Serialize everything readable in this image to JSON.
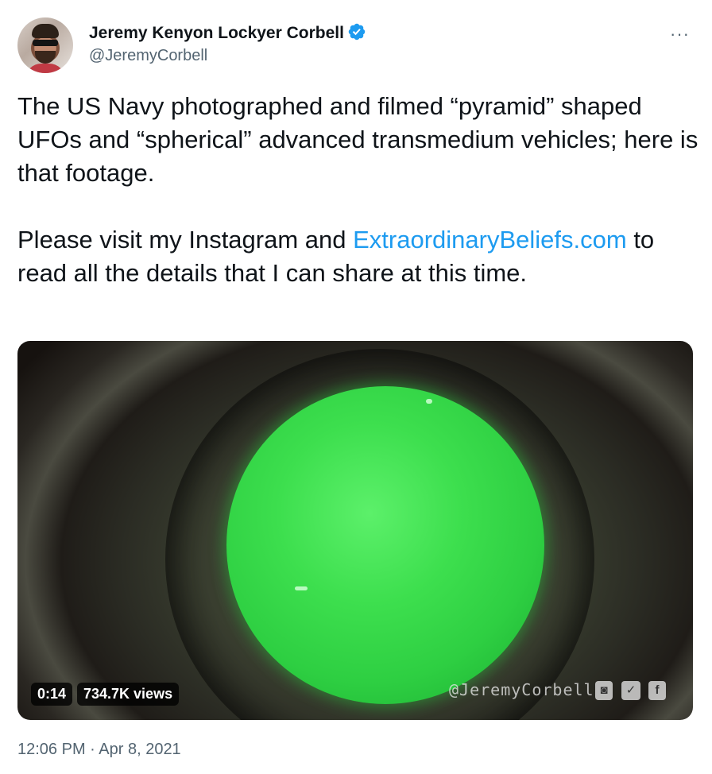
{
  "author": {
    "name": "Jeremy Kenyon Lockyer Corbell",
    "handle": "@JeremyCorbell",
    "verified": true
  },
  "menu": {
    "more_label": "···"
  },
  "tweet": {
    "text_part1": "The US Navy photographed and filmed “pyramid” shaped UFOs and “spherical” advanced transmedium vehicles; here is that footage.\n\nPlease visit my Instagram and ",
    "link_text": "ExtraordinaryBeliefs.com",
    "text_part2": " to read all the details that I can share at this time."
  },
  "video": {
    "duration": "0:14",
    "views": "734.7K views",
    "watermark": "@JeremyCorbell",
    "social_icons": [
      "instagram-icon",
      "twitter-icon",
      "facebook-icon"
    ]
  },
  "timestamp": "12:06 PM · Apr 8, 2021",
  "colors": {
    "link": "#1d9bf0",
    "verified": "#1d9bf0",
    "secondary_text": "#536471",
    "orb_green": "#3ddf4e"
  }
}
